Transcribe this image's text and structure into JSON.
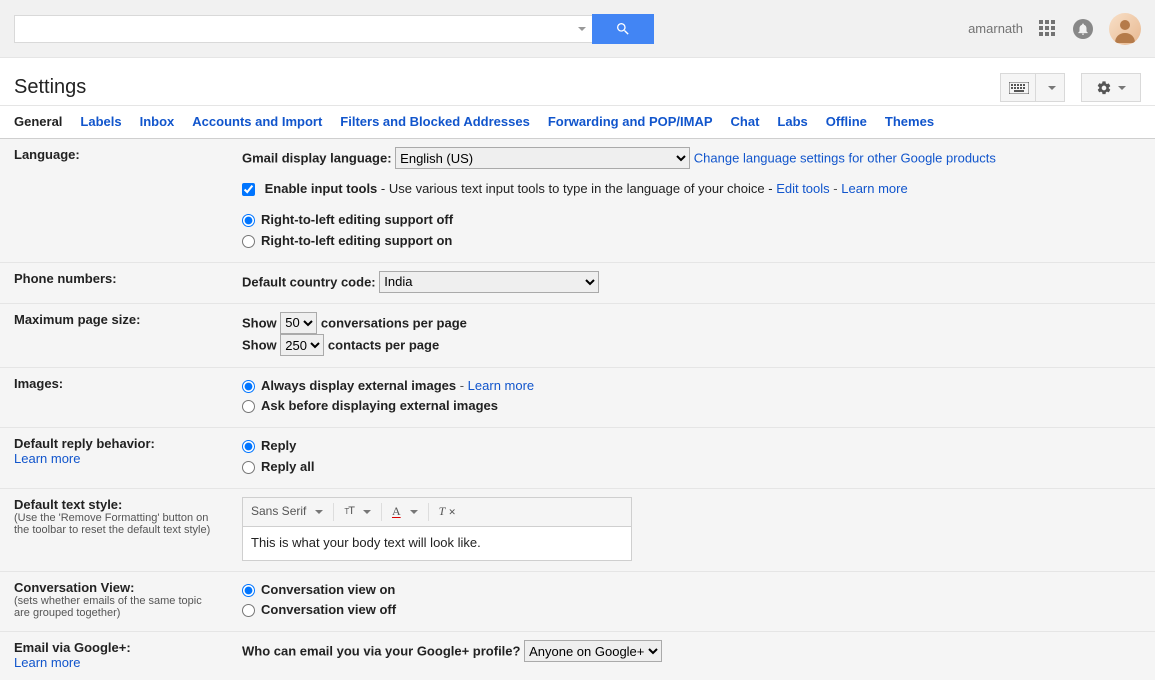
{
  "header": {
    "user": "amarnath"
  },
  "pageTitle": "Settings",
  "tabs": [
    {
      "label": "General",
      "active": true
    },
    {
      "label": "Labels"
    },
    {
      "label": "Inbox"
    },
    {
      "label": "Accounts and Import"
    },
    {
      "label": "Filters and Blocked Addresses"
    },
    {
      "label": "Forwarding and POP/IMAP"
    },
    {
      "label": "Chat"
    },
    {
      "label": "Labs"
    },
    {
      "label": "Offline"
    },
    {
      "label": "Themes"
    }
  ],
  "language": {
    "label": "Language:",
    "displayLangLabel": "Gmail display language:",
    "displayLangValue": "English (US)",
    "changeLink": "Change language settings for other Google products",
    "enableInputTools": "Enable input tools",
    "enableInputToolsDesc": " - Use various text input tools to type in the language of your choice - ",
    "editTools": "Edit tools",
    "learnMore": "Learn more",
    "rtlOff": "Right-to-left editing support off",
    "rtlOn": "Right-to-left editing support on"
  },
  "phone": {
    "label": "Phone numbers:",
    "defaultCountry": "Default country code:",
    "value": "India"
  },
  "pageSize": {
    "label": "Maximum page size:",
    "show": "Show",
    "convCount": "50",
    "convSuffix": "conversations per page",
    "contactCount": "250",
    "contactSuffix": "contacts per page"
  },
  "images": {
    "label": "Images:",
    "always": "Always display external images",
    "learnMore": "Learn more",
    "ask": "Ask before displaying external images"
  },
  "reply": {
    "label": "Default reply behavior:",
    "learnMore": "Learn more",
    "reply": "Reply",
    "replyAll": "Reply all"
  },
  "textStyle": {
    "label": "Default text style:",
    "note": "(Use the 'Remove Formatting' button on the toolbar to reset the default text style)",
    "font": "Sans Serif",
    "preview": "This is what your body text will look like."
  },
  "conversation": {
    "label": "Conversation View:",
    "note": "(sets whether emails of the same topic are grouped together)",
    "on": "Conversation view on",
    "off": "Conversation view off"
  },
  "googlePlus": {
    "label": "Email via Google+:",
    "learnMore": "Learn more",
    "question": "Who can email you via your Google+ profile?",
    "value": "Anyone on Google+"
  }
}
